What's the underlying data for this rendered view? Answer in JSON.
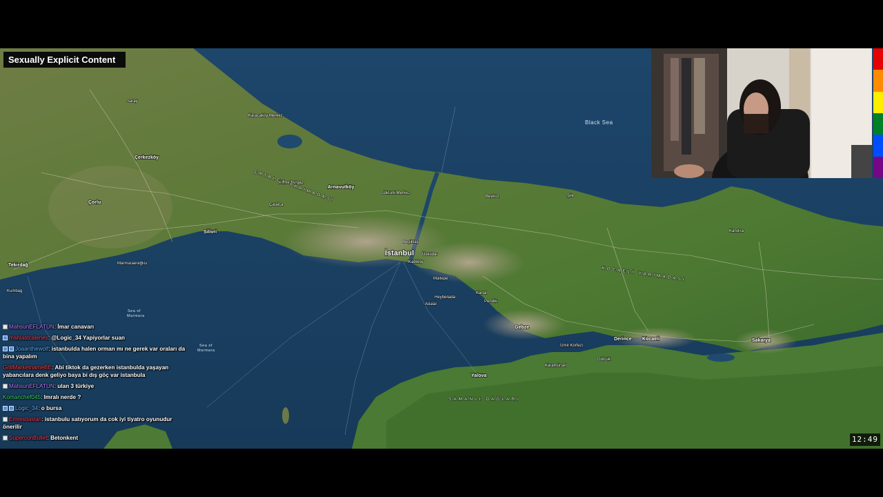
{
  "content_warning": "Sexually Explicit Content",
  "clock": "12:49",
  "map": {
    "seas": [
      "Black Sea",
      "Sea of Marmara",
      "Sea of Marmara"
    ],
    "main_city": "İstanbul",
    "cities": [
      "Tekirdağ",
      "Çorlu",
      "Silivri",
      "Çerkezköy",
      "Arnavutköy",
      "Gebze",
      "Kocaeli",
      "Sakarya",
      "Yalova",
      "İzmit Körfezi",
      "Derince",
      "Marmaraereğlisi",
      "Adalar",
      "Heybeliada",
      "Beykoz",
      "Kandıra",
      "Gölcük",
      "Kumbag",
      "Çatalca",
      "Karamürsel",
      "Kartal",
      "Maltepe",
      "Pendik",
      "Kadıköy",
      "Üsküdar",
      "Beşiktaş",
      "Şile",
      "Gökturk Merkez",
      "Kemerburgaz",
      "Karacaköy Merkez",
      "Saray"
    ],
    "regions": [
      "KOCAELİ YARIMADASI",
      "SAMANLI DAĞLARI",
      "ÇATALCA YARIMADASI"
    ]
  },
  "webcam": {
    "alt": "streamer webcam"
  },
  "pride_colors": [
    "#e40303",
    "#ff8c00",
    "#ffed00",
    "#008026",
    "#004dff",
    "#750787"
  ],
  "chat": [
    {
      "user": "MahsunEFLATUN",
      "color": "#b57bff",
      "badge": "w",
      "text": "İmar canavarı"
    },
    {
      "user": "mahlastcalenes",
      "color": "#ff3d5a",
      "badge": "b",
      "text": "@Logic_34 Yapiyorlar suan"
    },
    {
      "user": "Joaanthewolf",
      "color": "#5fb4ff",
      "badge": "b",
      "text": "istanbulda halen orman mı ne gerek var oraları da bina yapalım"
    },
    {
      "user": "GrillMarketnameBE",
      "color": "#ff4040",
      "badge": "",
      "text": "Abi tiktok da gezerken istanbulda yaşayan yabancılara denk geliyo baya bi dış göç var istanbula"
    },
    {
      "user": "MahsunEFLATUN",
      "color": "#b57bff",
      "badge": "w",
      "text": "ulan 3 türkiye"
    },
    {
      "user": "Komanchef045",
      "color": "#39d96b",
      "badge": "",
      "text": "Imralı nerde ?"
    },
    {
      "user": "Logic_34",
      "color": "#69b3ff",
      "badge": "b",
      "text": "o bursa"
    },
    {
      "user": "Emresitaslan",
      "color": "#ff3d5a",
      "badge": "w",
      "text": "istanbulu satıyorum da cok iyi tiyatro oyunudur önerilir"
    },
    {
      "user": "SuperconBullet",
      "color": "#ff3d5a",
      "badge": "w",
      "text": "Betonkent"
    }
  ]
}
